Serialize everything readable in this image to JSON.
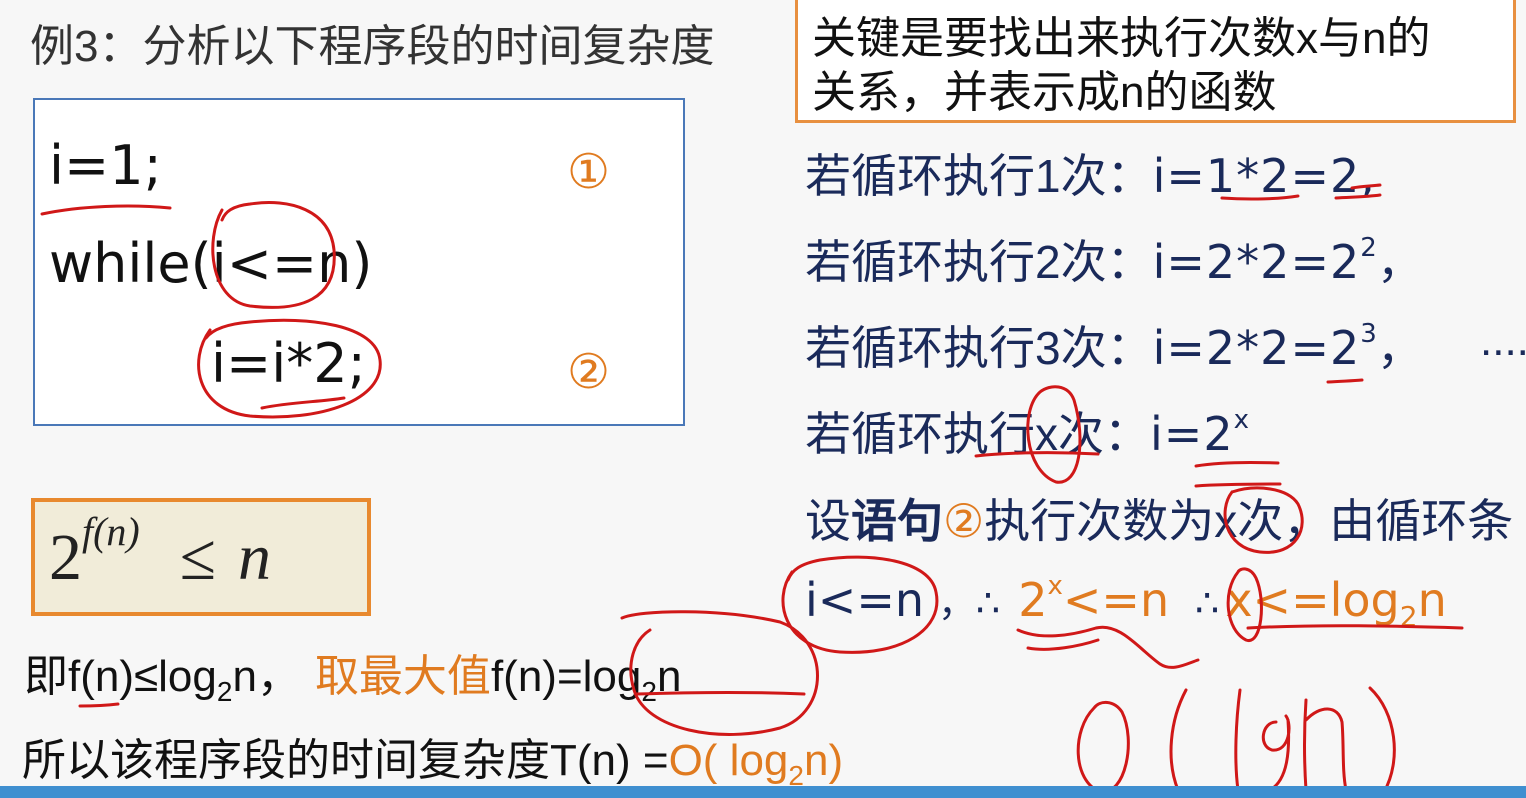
{
  "title": "例3：分析以下程序段的时间复杂度",
  "code": {
    "line1": "i=1;",
    "line2": "while(i<=n)",
    "line3": "i=i*2;",
    "mark1": "①",
    "mark2": "②"
  },
  "note": {
    "line1": "关键是要找出来执行次数x与n的",
    "line2": "关系，并表示成n的函数"
  },
  "iterations": [
    {
      "label": "若循环执行1次：",
      "expr": "i=1*2=2",
      "sup": "",
      "tail": ","
    },
    {
      "label": "若循环执行2次：",
      "expr": "i=2*2=2",
      "sup": "2",
      "tail": "，"
    },
    {
      "label": "若循环执行3次：",
      "expr": "i=2*2=2",
      "sup": "3",
      "tail": "，",
      "ellipsis": "...."
    },
    {
      "label": "若循环执行x次：",
      "expr": "i=2",
      "sup": "x",
      "tail": ""
    }
  ],
  "assume": {
    "prefix": "设",
    "bold": "语句",
    "mark": "②",
    "rest": "执行次数为x次，由循环条"
  },
  "condition": {
    "part1": "i<=n",
    "sep1": "，∴",
    "two": "2",
    "sup_x": "x",
    "part2": "<=n",
    "sep2": "∴",
    "part3": "x<=log",
    "sub2": "2",
    "part4": "n"
  },
  "formula": {
    "base": "2",
    "exponent": "f(n)",
    "relation": "≤",
    "var": "n"
  },
  "conclusion1": {
    "a": "即f(n)≤log",
    "a_sub": "2",
    "b": "n，",
    "c_orange": "取最大值",
    "d": "f(n)=log",
    "d_sub": "2",
    "e": "n"
  },
  "conclusion2": {
    "a": "所以该程序段的时间复杂度T(n) =",
    "b_orange": "O( log",
    "b_sub": "2",
    "c_orange": "n)"
  },
  "handwriting": {
    "note": "O(logn)"
  }
}
